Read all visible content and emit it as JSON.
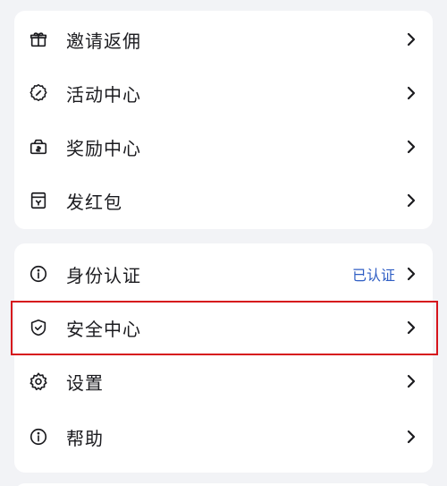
{
  "colors": {
    "page_bg": "#f2f3f6",
    "card_bg": "#ffffff",
    "text": "#1b1b1f",
    "status_text": "#2f5ec4",
    "highlight": "#d6141c"
  },
  "menu_group_1": [
    {
      "label": "邀请返佣",
      "icon": "gift-icon"
    },
    {
      "label": "活动中心",
      "icon": "activity-icon"
    },
    {
      "label": "奖励中心",
      "icon": "reward-box-icon"
    },
    {
      "label": "发红包",
      "icon": "red-packet-icon"
    }
  ],
  "menu_group_2": [
    {
      "label": "身份认证",
      "icon": "info-icon",
      "status": "已认证"
    },
    {
      "label": "安全中心",
      "icon": "shield-check-icon"
    },
    {
      "label": "设置",
      "icon": "gear-icon"
    },
    {
      "label": "帮助",
      "icon": "help-info-icon"
    }
  ]
}
